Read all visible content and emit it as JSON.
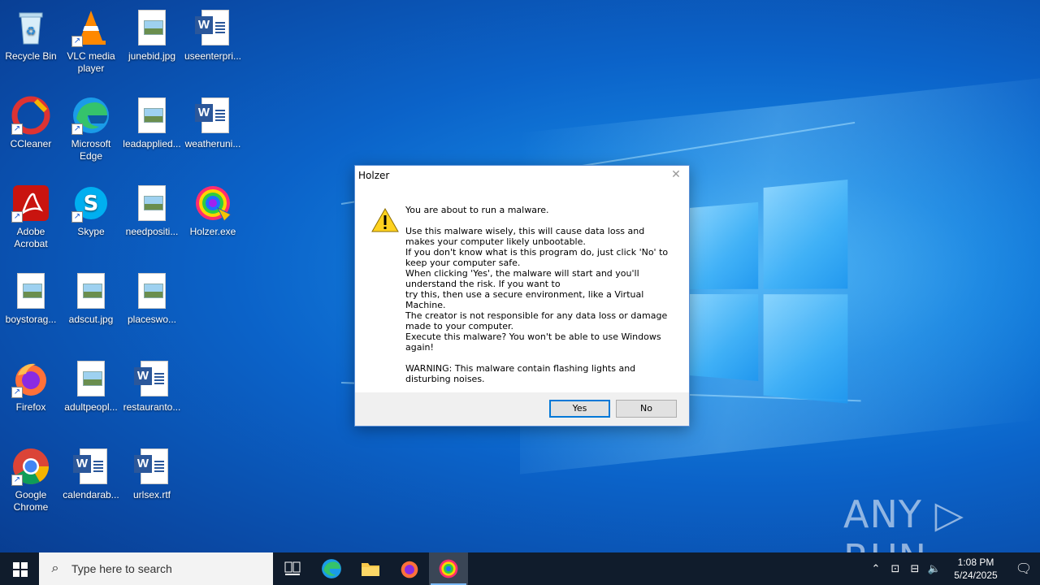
{
  "desktop": {
    "icons": [
      {
        "label": "Recycle Bin"
      },
      {
        "label": "VLC media player"
      },
      {
        "label": "junebid.jpg"
      },
      {
        "label": "useenterpri..."
      },
      {
        "label": "CCleaner"
      },
      {
        "label": "Microsoft Edge"
      },
      {
        "label": "leadapplied..."
      },
      {
        "label": "weatheruni..."
      },
      {
        "label": "Adobe Acrobat"
      },
      {
        "label": "Skype"
      },
      {
        "label": "needpositi..."
      },
      {
        "label": "Holzer.exe"
      },
      {
        "label": "boystorag..."
      },
      {
        "label": "adscut.jpg"
      },
      {
        "label": "placeswo..."
      },
      {
        "label": "Firefox"
      },
      {
        "label": "adultpeopl..."
      },
      {
        "label": "restauranto..."
      },
      {
        "label": "Google Chrome"
      },
      {
        "label": "calendarab..."
      },
      {
        "label": "urlsex.rtf"
      }
    ]
  },
  "dialog": {
    "title": "Holzer",
    "close_glyph": "✕",
    "line1": "You are about to run a malware.",
    "para2": "Use this malware wisely, this will cause data loss and makes your computer likely unbootable.",
    "para3": "If you don't know what is this program do, just click 'No' to keep your computer safe.",
    "para4": "When clicking 'Yes', the malware will start and you'll understand the risk. If you want to",
    "para5": "try this, then use a secure environment, like a Virtual Machine.",
    "para6": "The creator is not responsible for any data loss or damage made to your computer.",
    "para7": "Execute this malware? You won't be able to use Windows again!",
    "warning": "WARNING: This malware contain flashing lights and disturbing noises.",
    "yes_label": "Yes",
    "no_label": "No"
  },
  "watermark": "ANY ▷ RUN",
  "taskbar": {
    "search_placeholder": "Type here to search",
    "time": "1:08 PM",
    "date": "5/24/2025"
  }
}
